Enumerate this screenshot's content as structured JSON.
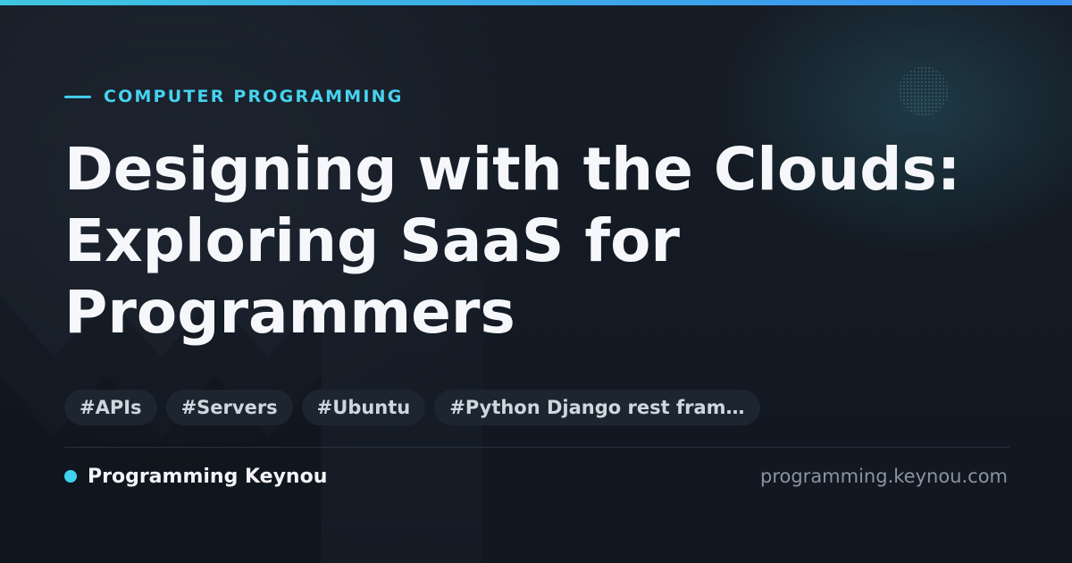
{
  "header": {
    "category": "COMPUTER PROGRAMMING",
    "title_lines": [
      "Designing with the Clouds:",
      "Exploring SaaS for",
      "Programmers"
    ]
  },
  "tags": [
    "#APIs",
    "#Servers",
    "#Ubuntu",
    "#Python Django rest fram…"
  ],
  "footer": {
    "brand": "Programming Keynou",
    "url": "programming.keynou.com"
  },
  "colors": {
    "accent": "#40d3ee",
    "background": "#121821",
    "tag_background": "#1c2530",
    "title_text": "#f5f7fa"
  }
}
